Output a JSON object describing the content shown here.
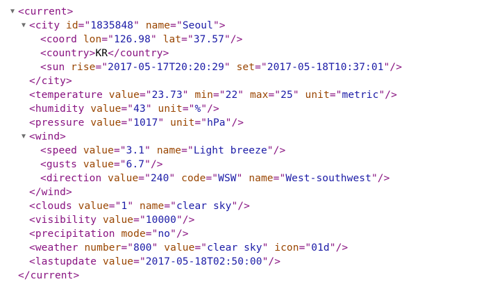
{
  "colors": {
    "tag": "#881280",
    "attr_name": "#994500",
    "attr_value": "#1a1aa6",
    "text": "#000000",
    "toggle": "#6e6e6e",
    "background": "#ffffff"
  },
  "toggle_icon": "triangle-down-icon",
  "lines": [
    {
      "depth": 0,
      "toggle": true,
      "tokens": [
        [
          "tag",
          "<current>"
        ]
      ]
    },
    {
      "depth": 1,
      "toggle": true,
      "tokens": [
        [
          "tag",
          "<city "
        ],
        [
          "an",
          "id"
        ],
        [
          "tag",
          "=\""
        ],
        [
          "av",
          "1835848"
        ],
        [
          "tag",
          "\" "
        ],
        [
          "an",
          "name"
        ],
        [
          "tag",
          "=\""
        ],
        [
          "av",
          "Seoul"
        ],
        [
          "tag",
          "\">"
        ]
      ]
    },
    {
      "depth": 2,
      "toggle": false,
      "tokens": [
        [
          "tag",
          "<coord "
        ],
        [
          "an",
          "lon"
        ],
        [
          "tag",
          "=\""
        ],
        [
          "av",
          "126.98"
        ],
        [
          "tag",
          "\" "
        ],
        [
          "an",
          "lat"
        ],
        [
          "tag",
          "=\""
        ],
        [
          "av",
          "37.57"
        ],
        [
          "tag",
          "\"/>"
        ]
      ]
    },
    {
      "depth": 2,
      "toggle": false,
      "tokens": [
        [
          "tag",
          "<country>"
        ],
        [
          "tx",
          "KR"
        ],
        [
          "tag",
          "</country>"
        ]
      ]
    },
    {
      "depth": 2,
      "toggle": false,
      "tokens": [
        [
          "tag",
          "<sun "
        ],
        [
          "an",
          "rise"
        ],
        [
          "tag",
          "=\""
        ],
        [
          "av",
          "2017-05-17T20:20:29"
        ],
        [
          "tag",
          "\" "
        ],
        [
          "an",
          "set"
        ],
        [
          "tag",
          "=\""
        ],
        [
          "av",
          "2017-05-18T10:37:01"
        ],
        [
          "tag",
          "\"/>"
        ]
      ]
    },
    {
      "depth": 1,
      "toggle": false,
      "tokens": [
        [
          "tag",
          "</city>"
        ]
      ]
    },
    {
      "depth": 1,
      "toggle": false,
      "tokens": [
        [
          "tag",
          "<temperature "
        ],
        [
          "an",
          "value"
        ],
        [
          "tag",
          "=\""
        ],
        [
          "av",
          "23.73"
        ],
        [
          "tag",
          "\" "
        ],
        [
          "an",
          "min"
        ],
        [
          "tag",
          "=\""
        ],
        [
          "av",
          "22"
        ],
        [
          "tag",
          "\" "
        ],
        [
          "an",
          "max"
        ],
        [
          "tag",
          "=\""
        ],
        [
          "av",
          "25"
        ],
        [
          "tag",
          "\" "
        ],
        [
          "an",
          "unit"
        ],
        [
          "tag",
          "=\""
        ],
        [
          "av",
          "metric"
        ],
        [
          "tag",
          "\"/>"
        ]
      ]
    },
    {
      "depth": 1,
      "toggle": false,
      "tokens": [
        [
          "tag",
          "<humidity "
        ],
        [
          "an",
          "value"
        ],
        [
          "tag",
          "=\""
        ],
        [
          "av",
          "43"
        ],
        [
          "tag",
          "\" "
        ],
        [
          "an",
          "unit"
        ],
        [
          "tag",
          "=\""
        ],
        [
          "av",
          "%"
        ],
        [
          "tag",
          "\"/>"
        ]
      ]
    },
    {
      "depth": 1,
      "toggle": false,
      "tokens": [
        [
          "tag",
          "<pressure "
        ],
        [
          "an",
          "value"
        ],
        [
          "tag",
          "=\""
        ],
        [
          "av",
          "1017"
        ],
        [
          "tag",
          "\" "
        ],
        [
          "an",
          "unit"
        ],
        [
          "tag",
          "=\""
        ],
        [
          "av",
          "hPa"
        ],
        [
          "tag",
          "\"/>"
        ]
      ]
    },
    {
      "depth": 1,
      "toggle": true,
      "tokens": [
        [
          "tag",
          "<wind>"
        ]
      ]
    },
    {
      "depth": 2,
      "toggle": false,
      "tokens": [
        [
          "tag",
          "<speed "
        ],
        [
          "an",
          "value"
        ],
        [
          "tag",
          "=\""
        ],
        [
          "av",
          "3.1"
        ],
        [
          "tag",
          "\" "
        ],
        [
          "an",
          "name"
        ],
        [
          "tag",
          "=\""
        ],
        [
          "av",
          "Light breeze"
        ],
        [
          "tag",
          "\"/>"
        ]
      ]
    },
    {
      "depth": 2,
      "toggle": false,
      "tokens": [
        [
          "tag",
          "<gusts "
        ],
        [
          "an",
          "value"
        ],
        [
          "tag",
          "=\""
        ],
        [
          "av",
          "6.7"
        ],
        [
          "tag",
          "\"/>"
        ]
      ]
    },
    {
      "depth": 2,
      "toggle": false,
      "tokens": [
        [
          "tag",
          "<direction "
        ],
        [
          "an",
          "value"
        ],
        [
          "tag",
          "=\""
        ],
        [
          "av",
          "240"
        ],
        [
          "tag",
          "\" "
        ],
        [
          "an",
          "code"
        ],
        [
          "tag",
          "=\""
        ],
        [
          "av",
          "WSW"
        ],
        [
          "tag",
          "\" "
        ],
        [
          "an",
          "name"
        ],
        [
          "tag",
          "=\""
        ],
        [
          "av",
          "West-southwest"
        ],
        [
          "tag",
          "\"/>"
        ]
      ]
    },
    {
      "depth": 1,
      "toggle": false,
      "tokens": [
        [
          "tag",
          "</wind>"
        ]
      ]
    },
    {
      "depth": 1,
      "toggle": false,
      "tokens": [
        [
          "tag",
          "<clouds "
        ],
        [
          "an",
          "value"
        ],
        [
          "tag",
          "=\""
        ],
        [
          "av",
          "1"
        ],
        [
          "tag",
          "\" "
        ],
        [
          "an",
          "name"
        ],
        [
          "tag",
          "=\""
        ],
        [
          "av",
          "clear sky"
        ],
        [
          "tag",
          "\"/>"
        ]
      ]
    },
    {
      "depth": 1,
      "toggle": false,
      "tokens": [
        [
          "tag",
          "<visibility "
        ],
        [
          "an",
          "value"
        ],
        [
          "tag",
          "=\""
        ],
        [
          "av",
          "10000"
        ],
        [
          "tag",
          "\"/>"
        ]
      ]
    },
    {
      "depth": 1,
      "toggle": false,
      "tokens": [
        [
          "tag",
          "<precipitation "
        ],
        [
          "an",
          "mode"
        ],
        [
          "tag",
          "=\""
        ],
        [
          "av",
          "no"
        ],
        [
          "tag",
          "\"/>"
        ]
      ]
    },
    {
      "depth": 1,
      "toggle": false,
      "tokens": [
        [
          "tag",
          "<weather "
        ],
        [
          "an",
          "number"
        ],
        [
          "tag",
          "=\""
        ],
        [
          "av",
          "800"
        ],
        [
          "tag",
          "\" "
        ],
        [
          "an",
          "value"
        ],
        [
          "tag",
          "=\""
        ],
        [
          "av",
          "clear sky"
        ],
        [
          "tag",
          "\" "
        ],
        [
          "an",
          "icon"
        ],
        [
          "tag",
          "=\""
        ],
        [
          "av",
          "01d"
        ],
        [
          "tag",
          "\"/>"
        ]
      ]
    },
    {
      "depth": 1,
      "toggle": false,
      "tokens": [
        [
          "tag",
          "<lastupdate "
        ],
        [
          "an",
          "value"
        ],
        [
          "tag",
          "=\""
        ],
        [
          "av",
          "2017-05-18T02:50:00"
        ],
        [
          "tag",
          "\"/>"
        ]
      ]
    },
    {
      "depth": 0,
      "toggle": false,
      "tokens": [
        [
          "tag",
          "</current>"
        ]
      ]
    }
  ]
}
